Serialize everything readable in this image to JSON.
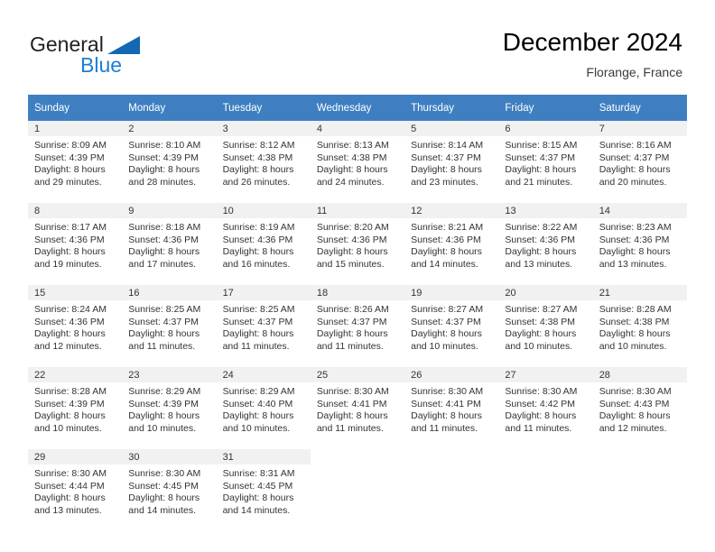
{
  "brand": {
    "word1": "General",
    "word2": "Blue",
    "triangle_color": "#1268b3",
    "blue_color": "#1c7fd4"
  },
  "header": {
    "title": "December 2024",
    "subtitle": "Florange, France"
  },
  "theme": {
    "header_row_bg": "#3f7fc1",
    "daynum_bg": "#f1f1f1",
    "text": "#333333"
  },
  "weekday_headers": [
    "Sunday",
    "Monday",
    "Tuesday",
    "Wednesday",
    "Thursday",
    "Friday",
    "Saturday"
  ],
  "weeks": [
    [
      {
        "day": "1",
        "sunrise": "Sunrise: 8:09 AM",
        "sunset": "Sunset: 4:39 PM",
        "daylight1": "Daylight: 8 hours",
        "daylight2": "and 29 minutes."
      },
      {
        "day": "2",
        "sunrise": "Sunrise: 8:10 AM",
        "sunset": "Sunset: 4:39 PM",
        "daylight1": "Daylight: 8 hours",
        "daylight2": "and 28 minutes."
      },
      {
        "day": "3",
        "sunrise": "Sunrise: 8:12 AM",
        "sunset": "Sunset: 4:38 PM",
        "daylight1": "Daylight: 8 hours",
        "daylight2": "and 26 minutes."
      },
      {
        "day": "4",
        "sunrise": "Sunrise: 8:13 AM",
        "sunset": "Sunset: 4:38 PM",
        "daylight1": "Daylight: 8 hours",
        "daylight2": "and 24 minutes."
      },
      {
        "day": "5",
        "sunrise": "Sunrise: 8:14 AM",
        "sunset": "Sunset: 4:37 PM",
        "daylight1": "Daylight: 8 hours",
        "daylight2": "and 23 minutes."
      },
      {
        "day": "6",
        "sunrise": "Sunrise: 8:15 AM",
        "sunset": "Sunset: 4:37 PM",
        "daylight1": "Daylight: 8 hours",
        "daylight2": "and 21 minutes."
      },
      {
        "day": "7",
        "sunrise": "Sunrise: 8:16 AM",
        "sunset": "Sunset: 4:37 PM",
        "daylight1": "Daylight: 8 hours",
        "daylight2": "and 20 minutes."
      }
    ],
    [
      {
        "day": "8",
        "sunrise": "Sunrise: 8:17 AM",
        "sunset": "Sunset: 4:36 PM",
        "daylight1": "Daylight: 8 hours",
        "daylight2": "and 19 minutes."
      },
      {
        "day": "9",
        "sunrise": "Sunrise: 8:18 AM",
        "sunset": "Sunset: 4:36 PM",
        "daylight1": "Daylight: 8 hours",
        "daylight2": "and 17 minutes."
      },
      {
        "day": "10",
        "sunrise": "Sunrise: 8:19 AM",
        "sunset": "Sunset: 4:36 PM",
        "daylight1": "Daylight: 8 hours",
        "daylight2": "and 16 minutes."
      },
      {
        "day": "11",
        "sunrise": "Sunrise: 8:20 AM",
        "sunset": "Sunset: 4:36 PM",
        "daylight1": "Daylight: 8 hours",
        "daylight2": "and 15 minutes."
      },
      {
        "day": "12",
        "sunrise": "Sunrise: 8:21 AM",
        "sunset": "Sunset: 4:36 PM",
        "daylight1": "Daylight: 8 hours",
        "daylight2": "and 14 minutes."
      },
      {
        "day": "13",
        "sunrise": "Sunrise: 8:22 AM",
        "sunset": "Sunset: 4:36 PM",
        "daylight1": "Daylight: 8 hours",
        "daylight2": "and 13 minutes."
      },
      {
        "day": "14",
        "sunrise": "Sunrise: 8:23 AM",
        "sunset": "Sunset: 4:36 PM",
        "daylight1": "Daylight: 8 hours",
        "daylight2": "and 13 minutes."
      }
    ],
    [
      {
        "day": "15",
        "sunrise": "Sunrise: 8:24 AM",
        "sunset": "Sunset: 4:36 PM",
        "daylight1": "Daylight: 8 hours",
        "daylight2": "and 12 minutes."
      },
      {
        "day": "16",
        "sunrise": "Sunrise: 8:25 AM",
        "sunset": "Sunset: 4:37 PM",
        "daylight1": "Daylight: 8 hours",
        "daylight2": "and 11 minutes."
      },
      {
        "day": "17",
        "sunrise": "Sunrise: 8:25 AM",
        "sunset": "Sunset: 4:37 PM",
        "daylight1": "Daylight: 8 hours",
        "daylight2": "and 11 minutes."
      },
      {
        "day": "18",
        "sunrise": "Sunrise: 8:26 AM",
        "sunset": "Sunset: 4:37 PM",
        "daylight1": "Daylight: 8 hours",
        "daylight2": "and 11 minutes."
      },
      {
        "day": "19",
        "sunrise": "Sunrise: 8:27 AM",
        "sunset": "Sunset: 4:37 PM",
        "daylight1": "Daylight: 8 hours",
        "daylight2": "and 10 minutes."
      },
      {
        "day": "20",
        "sunrise": "Sunrise: 8:27 AM",
        "sunset": "Sunset: 4:38 PM",
        "daylight1": "Daylight: 8 hours",
        "daylight2": "and 10 minutes."
      },
      {
        "day": "21",
        "sunrise": "Sunrise: 8:28 AM",
        "sunset": "Sunset: 4:38 PM",
        "daylight1": "Daylight: 8 hours",
        "daylight2": "and 10 minutes."
      }
    ],
    [
      {
        "day": "22",
        "sunrise": "Sunrise: 8:28 AM",
        "sunset": "Sunset: 4:39 PM",
        "daylight1": "Daylight: 8 hours",
        "daylight2": "and 10 minutes."
      },
      {
        "day": "23",
        "sunrise": "Sunrise: 8:29 AM",
        "sunset": "Sunset: 4:39 PM",
        "daylight1": "Daylight: 8 hours",
        "daylight2": "and 10 minutes."
      },
      {
        "day": "24",
        "sunrise": "Sunrise: 8:29 AM",
        "sunset": "Sunset: 4:40 PM",
        "daylight1": "Daylight: 8 hours",
        "daylight2": "and 10 minutes."
      },
      {
        "day": "25",
        "sunrise": "Sunrise: 8:30 AM",
        "sunset": "Sunset: 4:41 PM",
        "daylight1": "Daylight: 8 hours",
        "daylight2": "and 11 minutes."
      },
      {
        "day": "26",
        "sunrise": "Sunrise: 8:30 AM",
        "sunset": "Sunset: 4:41 PM",
        "daylight1": "Daylight: 8 hours",
        "daylight2": "and 11 minutes."
      },
      {
        "day": "27",
        "sunrise": "Sunrise: 8:30 AM",
        "sunset": "Sunset: 4:42 PM",
        "daylight1": "Daylight: 8 hours",
        "daylight2": "and 11 minutes."
      },
      {
        "day": "28",
        "sunrise": "Sunrise: 8:30 AM",
        "sunset": "Sunset: 4:43 PM",
        "daylight1": "Daylight: 8 hours",
        "daylight2": "and 12 minutes."
      }
    ],
    [
      {
        "day": "29",
        "sunrise": "Sunrise: 8:30 AM",
        "sunset": "Sunset: 4:44 PM",
        "daylight1": "Daylight: 8 hours",
        "daylight2": "and 13 minutes."
      },
      {
        "day": "30",
        "sunrise": "Sunrise: 8:30 AM",
        "sunset": "Sunset: 4:45 PM",
        "daylight1": "Daylight: 8 hours",
        "daylight2": "and 14 minutes."
      },
      {
        "day": "31",
        "sunrise": "Sunrise: 8:31 AM",
        "sunset": "Sunset: 4:45 PM",
        "daylight1": "Daylight: 8 hours",
        "daylight2": "and 14 minutes."
      },
      {
        "day": "",
        "sunrise": "",
        "sunset": "",
        "daylight1": "",
        "daylight2": ""
      },
      {
        "day": "",
        "sunrise": "",
        "sunset": "",
        "daylight1": "",
        "daylight2": ""
      },
      {
        "day": "",
        "sunrise": "",
        "sunset": "",
        "daylight1": "",
        "daylight2": ""
      },
      {
        "day": "",
        "sunrise": "",
        "sunset": "",
        "daylight1": "",
        "daylight2": ""
      }
    ]
  ]
}
